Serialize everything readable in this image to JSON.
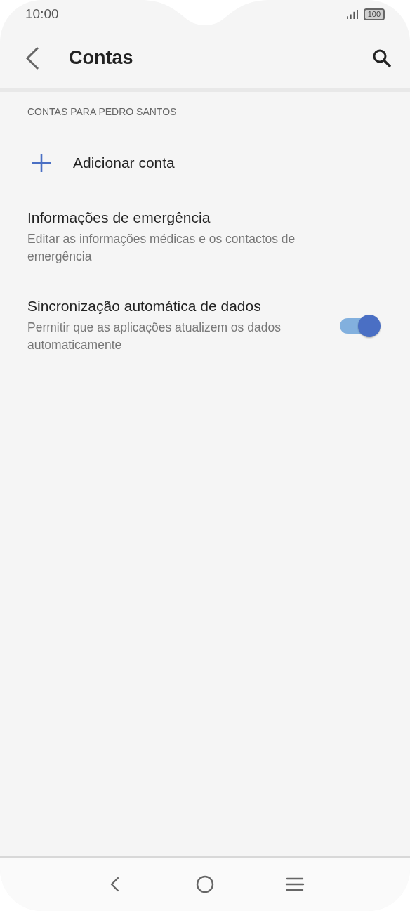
{
  "status_bar": {
    "time": "10:00",
    "battery": "100"
  },
  "app_bar": {
    "title": "Contas"
  },
  "section_header": "CONTAS PARA PEDRO SANTOS",
  "items": [
    {
      "kind": "action",
      "title": "Adicionar conta"
    },
    {
      "kind": "info",
      "title": "Informações de emergência",
      "subtitle": "Editar as informações médicas e os contactos de emergência"
    },
    {
      "kind": "toggle",
      "title": "Sincronização automática de dados",
      "subtitle": "Permitir que as aplicações atualizem os dados automaticamente",
      "on": true
    }
  ]
}
